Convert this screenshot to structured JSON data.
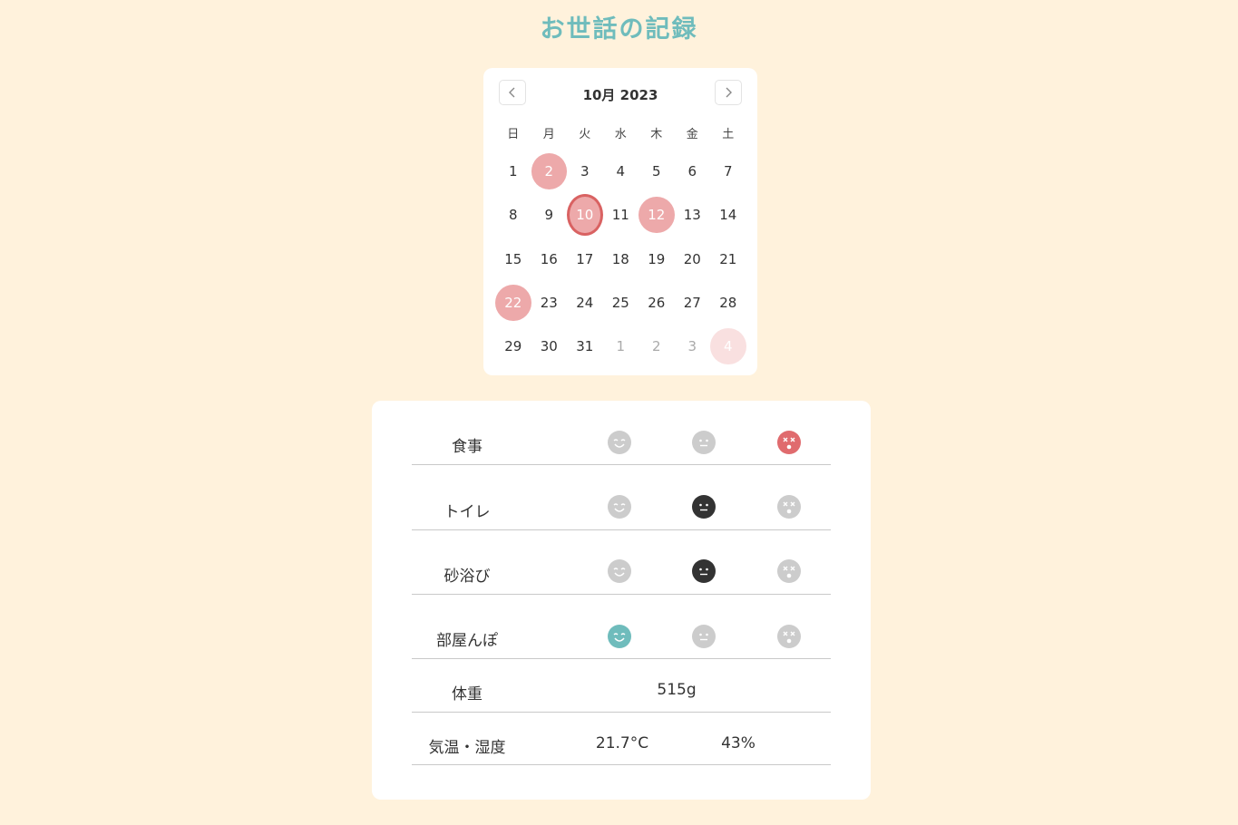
{
  "page": {
    "title": "お世話の記録"
  },
  "calendar": {
    "month_label": "10月 2023",
    "prev_icon": "chevron-left-icon",
    "next_icon": "chevron-right-icon",
    "weekdays": [
      "日",
      "月",
      "火",
      "水",
      "木",
      "金",
      "土"
    ],
    "days": [
      {
        "label": "1",
        "state": "normal"
      },
      {
        "label": "2",
        "state": "marked"
      },
      {
        "label": "3",
        "state": "normal"
      },
      {
        "label": "4",
        "state": "normal"
      },
      {
        "label": "5",
        "state": "normal"
      },
      {
        "label": "6",
        "state": "normal"
      },
      {
        "label": "7",
        "state": "normal"
      },
      {
        "label": "8",
        "state": "normal"
      },
      {
        "label": "9",
        "state": "normal"
      },
      {
        "label": "10",
        "state": "selected"
      },
      {
        "label": "11",
        "state": "normal"
      },
      {
        "label": "12",
        "state": "marked"
      },
      {
        "label": "13",
        "state": "normal"
      },
      {
        "label": "14",
        "state": "normal"
      },
      {
        "label": "15",
        "state": "normal"
      },
      {
        "label": "16",
        "state": "normal"
      },
      {
        "label": "17",
        "state": "normal"
      },
      {
        "label": "18",
        "state": "normal"
      },
      {
        "label": "19",
        "state": "normal"
      },
      {
        "label": "20",
        "state": "normal"
      },
      {
        "label": "21",
        "state": "normal"
      },
      {
        "label": "22",
        "state": "marked"
      },
      {
        "label": "23",
        "state": "normal"
      },
      {
        "label": "24",
        "state": "normal"
      },
      {
        "label": "25",
        "state": "normal"
      },
      {
        "label": "26",
        "state": "normal"
      },
      {
        "label": "27",
        "state": "normal"
      },
      {
        "label": "28",
        "state": "normal"
      },
      {
        "label": "29",
        "state": "normal"
      },
      {
        "label": "30",
        "state": "normal"
      },
      {
        "label": "31",
        "state": "normal"
      },
      {
        "label": "1",
        "state": "other"
      },
      {
        "label": "2",
        "state": "other"
      },
      {
        "label": "3",
        "state": "other"
      },
      {
        "label": "4",
        "state": "other-marked"
      }
    ]
  },
  "record": {
    "meal": {
      "label": "食事",
      "selected": "bad",
      "selected_color": "#e06b6e"
    },
    "toilet": {
      "label": "トイレ",
      "selected": "neutral",
      "selected_color": "#333333"
    },
    "sandbath": {
      "label": "砂浴び",
      "selected": "neutral",
      "selected_color": "#333333"
    },
    "roamroom": {
      "label": "部屋んぽ",
      "selected": "good",
      "selected_color": "#6fbcbc"
    },
    "weight": {
      "label": "体重",
      "value": "515g"
    },
    "climate": {
      "label": "気温・湿度",
      "temperature": "21.7°C",
      "humidity": "43%"
    }
  },
  "colors": {
    "background": "#fff2dc",
    "accent": "#6fbcbc",
    "marked_day": "#eda9aa",
    "selected_ring": "#d96262",
    "inactive_face": "#cccccc"
  },
  "icons": {
    "good": "happy-face-icon",
    "neutral": "neutral-face-icon",
    "bad": "dizzy-face-icon"
  }
}
